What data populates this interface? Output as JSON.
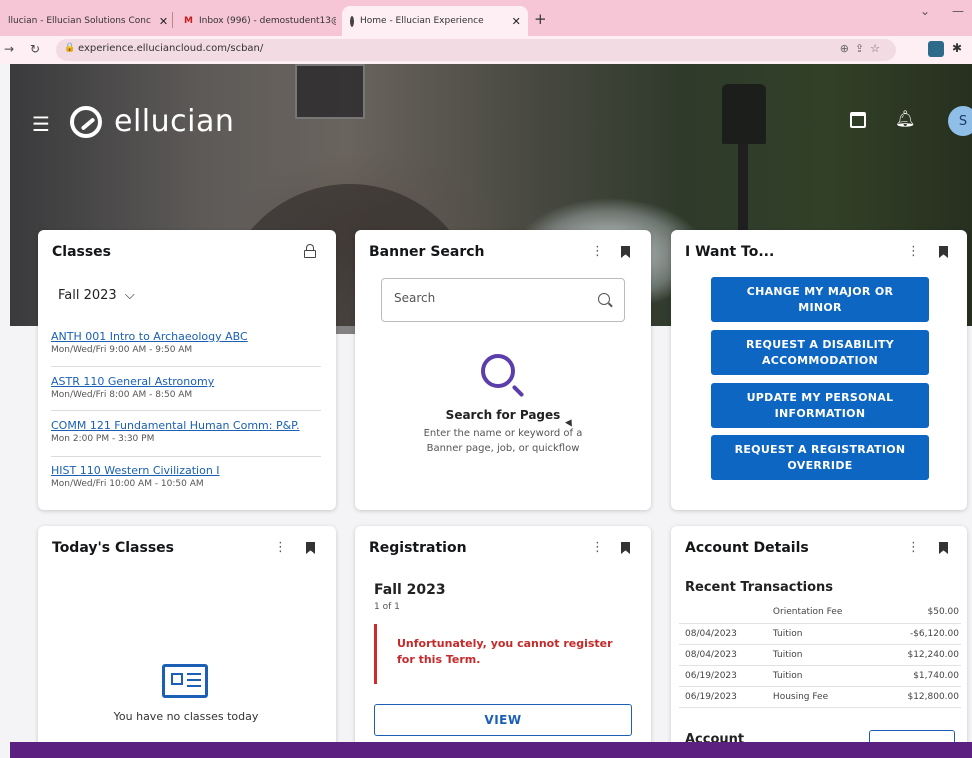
{
  "browser": {
    "tabs": [
      {
        "label": "llucian - Ellucian Solutions Conc",
        "active": false
      },
      {
        "label": "Inbox (996) - demostudent13@",
        "active": false
      },
      {
        "label": "Home - Ellucian Experience",
        "active": true
      }
    ],
    "new_tab": "+",
    "url": "experience.elluciancloud.com/scban/"
  },
  "header": {
    "brand": "ellucian",
    "avatar_initial": "S"
  },
  "classes": {
    "title": "Classes",
    "term": "Fall 2023",
    "items": [
      {
        "name": "ANTH 001 Intro to Archaeology ABC",
        "time": "Mon/Wed/Fri 9:00 AM - 9:50 AM"
      },
      {
        "name": "ASTR 110 General Astronomy",
        "time": "Mon/Wed/Fri 8:00 AM - 8:50 AM"
      },
      {
        "name": "COMM 121 Fundamental Human Comm: P&P.",
        "time": "Mon 2:00 PM - 3:30 PM"
      },
      {
        "name": "HIST 110 Western Civilization I",
        "time": "Mon/Wed/Fri 10:00 AM - 10:50 AM"
      }
    ]
  },
  "banner_search": {
    "title": "Banner Search",
    "placeholder": "Search",
    "empty_title": "Search for Pages",
    "empty_desc": "Enter the name or keyword of a Banner page, job, or quickflow"
  },
  "i_want_to": {
    "title": "I Want To...",
    "buttons": [
      "CHANGE MY MAJOR OR MINOR",
      "REQUEST A DISABILITY ACCOMMODATION",
      "UPDATE MY PERSONAL INFORMATION",
      "REQUEST A REGISTRATION OVERRIDE"
    ]
  },
  "todays_classes": {
    "title": "Today's Classes",
    "empty_text": "You have no classes today"
  },
  "registration": {
    "title": "Registration",
    "term": "Fall 2023",
    "count": "1 of 1",
    "alert": "Unfortunately, you cannot register for this Term.",
    "view_label": "VIEW"
  },
  "account_details": {
    "title": "Account Details",
    "recent_title": "Recent Transactions",
    "transactions": [
      {
        "date": "",
        "desc": "Orientation Fee",
        "amount": "$50.00"
      },
      {
        "date": "08/04/2023",
        "desc": "Tuition",
        "amount": "-$6,120.00"
      },
      {
        "date": "08/04/2023",
        "desc": "Tuition",
        "amount": "$12,240.00"
      },
      {
        "date": "06/19/2023",
        "desc": "Tuition",
        "amount": "$1,740.00"
      },
      {
        "date": "06/19/2023",
        "desc": "Housing Fee",
        "amount": "$12,800.00"
      }
    ],
    "account_subtitle": "Account"
  },
  "colors": {
    "primary": "#0d66c2",
    "accent_purple": "#5b3eaa",
    "alert_red": "#c42a2a",
    "footer_purple": "#5b2080",
    "tabbar_pink": "#f6c6d6"
  }
}
